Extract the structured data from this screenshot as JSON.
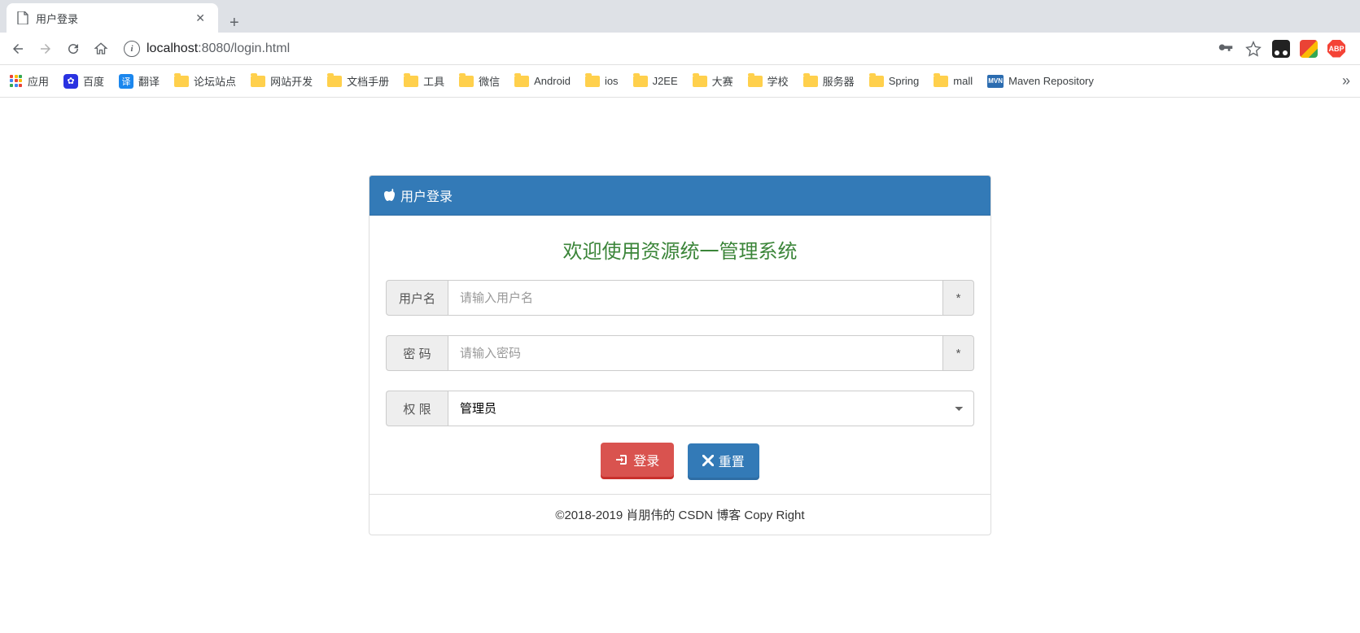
{
  "browser": {
    "tab_title": "用户登录",
    "url_host": "localhost",
    "url_port": ":8080",
    "url_path": "/login.html"
  },
  "bookmarks": {
    "apps": "应用",
    "items": [
      "百度",
      "翻译",
      "论坛站点",
      "网站开发",
      "文档手册",
      "工具",
      "微信",
      "Android",
      "ios",
      "J2EE",
      "大赛",
      "学校",
      "服务器",
      "Spring",
      "mall",
      "Maven Repository"
    ]
  },
  "panel": {
    "header": "用户登录",
    "welcome": "欢迎使用资源统一管理系统",
    "username_label": "用户名",
    "username_placeholder": "请输入用户名",
    "password_label": "密  码",
    "password_placeholder": "请输入密码",
    "role_label": "权  限",
    "role_value": "管理员",
    "required": "*",
    "login_btn": "登录",
    "reset_btn": "重置",
    "footer": "©2018-2019 肖朋伟的 CSDN 博客 Copy Right"
  }
}
